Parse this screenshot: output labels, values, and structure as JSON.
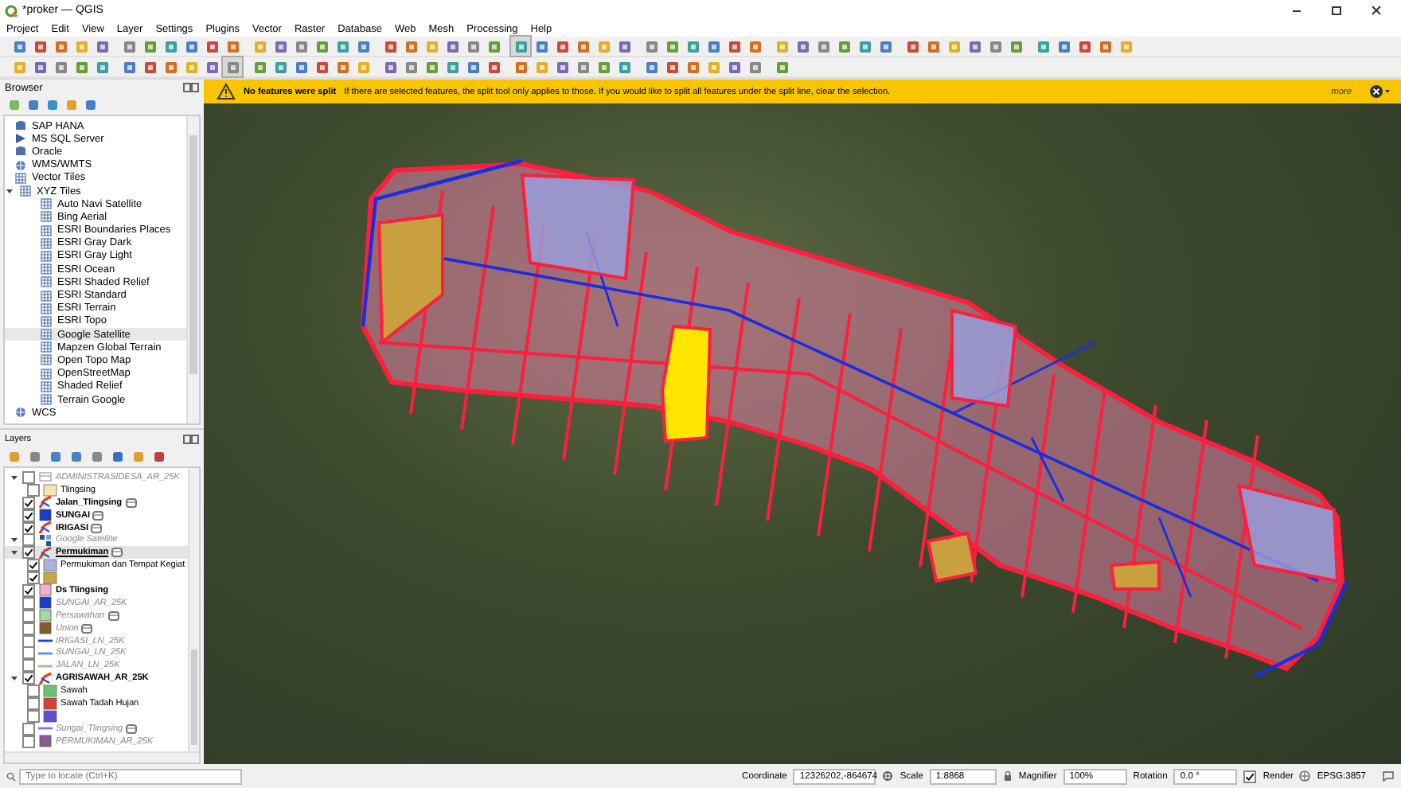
{
  "window": {
    "title": "*proker — QGIS"
  },
  "menu": [
    "Project",
    "Edit",
    "View",
    "Layer",
    "Settings",
    "Plugins",
    "Vector",
    "Raster",
    "Database",
    "Web",
    "Mesh",
    "Processing",
    "Help"
  ],
  "message_bar": {
    "title": "No features were split",
    "text": "If there are selected features, the split tool only applies to those. If you would like to split all features under the split line, clear the selection.",
    "link": "more"
  },
  "browser": {
    "title": "Browser",
    "items": [
      {
        "label": "SAP HANA",
        "kind": "database",
        "selected": false
      },
      {
        "label": "MS SQL Server",
        "kind": "server",
        "selected": false
      },
      {
        "label": "Oracle",
        "kind": "database",
        "selected": false
      },
      {
        "label": "WMS/WMTS",
        "kind": "globe",
        "selected": false
      },
      {
        "label": "Vector Tiles",
        "kind": "grid",
        "selected": false
      },
      {
        "label": "XYZ Tiles",
        "kind": "grid",
        "selected": false,
        "expanded": true,
        "children": [
          {
            "label": "Auto Navi Satellite",
            "kind": "grid",
            "selected": false
          },
          {
            "label": "Bing Aerial",
            "kind": "grid",
            "selected": false
          },
          {
            "label": "ESRI Boundaries Places",
            "kind": "grid",
            "selected": false
          },
          {
            "label": "ESRI Gray Dark",
            "kind": "grid",
            "selected": false
          },
          {
            "label": "ESRI Gray Light",
            "kind": "grid",
            "selected": false
          },
          {
            "label": "ESRI Ocean",
            "kind": "grid",
            "selected": false
          },
          {
            "label": "ESRI Shaded Relief",
            "kind": "grid",
            "selected": false
          },
          {
            "label": "ESRI Standard",
            "kind": "grid",
            "selected": false
          },
          {
            "label": "ESRI Terrain",
            "kind": "grid",
            "selected": false
          },
          {
            "label": "ESRI Topo",
            "kind": "grid",
            "selected": false
          },
          {
            "label": "Google Satellite",
            "kind": "grid",
            "selected": true
          },
          {
            "label": "Mapzen Global Terrain",
            "kind": "grid",
            "selected": false
          },
          {
            "label": "Open Topo Map",
            "kind": "grid",
            "selected": false
          },
          {
            "label": "OpenStreetMap",
            "kind": "grid",
            "selected": false
          },
          {
            "label": "Shaded Relief",
            "kind": "grid",
            "selected": false
          },
          {
            "label": "Terrain Google",
            "kind": "grid",
            "selected": false
          }
        ]
      },
      {
        "label": "WCS",
        "kind": "globe",
        "selected": false
      }
    ]
  },
  "layers": {
    "title": "Layers",
    "items": [
      {
        "label": "ADMINISTRASIDESA_AR_25K",
        "checked": false,
        "selected": false,
        "kind": "table",
        "expanded": true,
        "children": [
          {
            "label": "Tlingsing",
            "checked": false,
            "color": "#f5e6b0"
          }
        ]
      },
      {
        "label": "Jalan_Tlingsing",
        "checked": true,
        "selected": false,
        "kind": "rules",
        "indicator": true
      },
      {
        "label": "SUNGAI",
        "checked": true,
        "selected": false,
        "kind": "fill",
        "color": "#1a3ccc",
        "indicator": true
      },
      {
        "label": "IRIGASI",
        "checked": true,
        "selected": false,
        "kind": "rules",
        "indicator": true
      },
      {
        "label": "Google Satellite",
        "checked": false,
        "selected": false,
        "kind": "raster",
        "expanded": true
      },
      {
        "label": "Permukiman",
        "checked": true,
        "selected": true,
        "kind": "rules",
        "expanded": true,
        "indicator": true,
        "children": [
          {
            "label": "Permukiman dan Tempat Kegiat",
            "checked": true,
            "color": "#a7b4e0"
          },
          {
            "checked": true,
            "color": "#c9a64a"
          }
        ]
      },
      {
        "label": "Ds Tlingsing",
        "checked": true,
        "selected": false,
        "kind": "fill",
        "color": "#f2b3c6"
      },
      {
        "label": "SUNGAI_AR_25K",
        "checked": false,
        "selected": false,
        "kind": "fill",
        "color": "#1a3ccc"
      },
      {
        "label": "Persawahan",
        "checked": false,
        "selected": false,
        "kind": "fill",
        "color": "#a9d6a0",
        "indicator": true
      },
      {
        "label": "Union",
        "checked": false,
        "selected": false,
        "kind": "fill",
        "color": "#8b5a2b",
        "indicator": true
      },
      {
        "label": "IRIGASI_LN_25K",
        "checked": false,
        "selected": false,
        "kind": "line",
        "color": "#1f3fdd"
      },
      {
        "label": "SUNGAI_LN_25K",
        "checked": false,
        "selected": false,
        "kind": "line",
        "color": "#4a90ff"
      },
      {
        "label": "JALAN_LN_25K",
        "checked": false,
        "selected": false,
        "kind": "line",
        "color": "#d4a080"
      },
      {
        "label": "AGRISAWAH_AR_25K",
        "checked": true,
        "selected": false,
        "kind": "rules",
        "expanded": true,
        "children": [
          {
            "label": "Sawah",
            "checked": false,
            "color": "#6cc46c"
          },
          {
            "label": "Sawah Tadah Hujan",
            "checked": false,
            "color": "#d84030"
          },
          {
            "checked": false,
            "color": "#6050d0"
          }
        ]
      },
      {
        "label": "Sungai_Tlingsing",
        "checked": false,
        "selected": false,
        "kind": "line",
        "color": "#6a7fe0",
        "indicator": true
      },
      {
        "label": "PERMUKIMAN_AR_25K",
        "checked": false,
        "selected": false,
        "kind": "fill",
        "color": "#8a5a9a"
      }
    ]
  },
  "status_bar": {
    "locate_placeholder": "Type to locate (Ctrl+K)",
    "coordinate_label": "Coordinate",
    "coordinate": "12326202,-864674",
    "scale_label": "Scale",
    "scale": "1:8868",
    "magnifier_label": "Magnifier",
    "magnifier": "100%",
    "rotation_label": "Rotation",
    "rotation": "0.0 °",
    "render_label": "Render",
    "render_checked": true,
    "crs": "EPSG:3857"
  }
}
